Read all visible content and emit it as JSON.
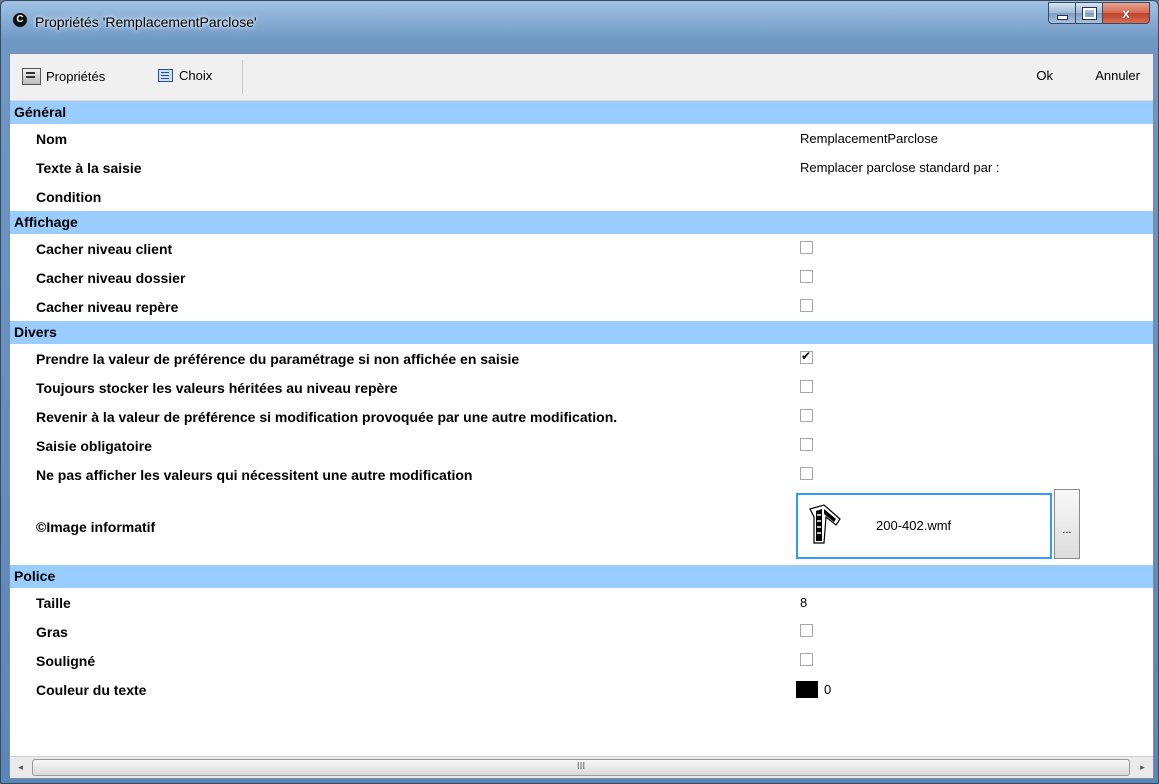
{
  "window": {
    "title": "Propriétés 'RemplacementParclose'",
    "app_icon": "c-logo-icon",
    "controls": {
      "minimize": "minimize-icon",
      "maximize": "maximize-icon",
      "close": "x"
    }
  },
  "toolbar": {
    "props_label": "Propriétés",
    "choix_label": "Choix",
    "ok_label": "Ok",
    "annuler_label": "Annuler"
  },
  "sections": {
    "general": {
      "title": "Général",
      "nom_label": "Nom",
      "nom_value": "RemplacementParclose",
      "texte_label": "Texte à la saisie",
      "texte_value": "Remplacer parclose standard par :",
      "condition_label": "Condition",
      "condition_value": ""
    },
    "affichage": {
      "title": "Affichage",
      "items": [
        {
          "label": "Cacher niveau client",
          "checked": false
        },
        {
          "label": "Cacher niveau dossier",
          "checked": false
        },
        {
          "label": "Cacher niveau repère",
          "checked": false
        }
      ]
    },
    "divers": {
      "title": "Divers",
      "items": [
        {
          "label": "Prendre la valeur de préférence du paramétrage si non affichée en saisie",
          "checked": true
        },
        {
          "label": "Toujours stocker les valeurs héritées au niveau repère",
          "checked": false
        },
        {
          "label": "Revenir à la valeur de préférence si modification provoquée par une autre modification.",
          "checked": false
        },
        {
          "label": "Saisie obligatoire",
          "checked": false
        },
        {
          "label": "Ne pas afficher les valeurs qui nécessitent une autre modification",
          "checked": false
        }
      ],
      "image_label": "©Image informatif",
      "image_file": "200-402.wmf",
      "browse_label": "..."
    },
    "police": {
      "title": "Police",
      "taille_label": "Taille",
      "taille_value": "8",
      "gras_label": "Gras",
      "gras_checked": false,
      "souligne_label": "Souligné",
      "souligne_checked": false,
      "couleur_label": "Couleur du texte",
      "couleur_value": "0",
      "couleur_swatch": "#000000"
    }
  },
  "scrollbar": {
    "left_arrow": "◂",
    "right_arrow": "▸",
    "grip": "III"
  },
  "colors": {
    "section_bg": "#99ccff",
    "selection_border": "#3399ff"
  }
}
